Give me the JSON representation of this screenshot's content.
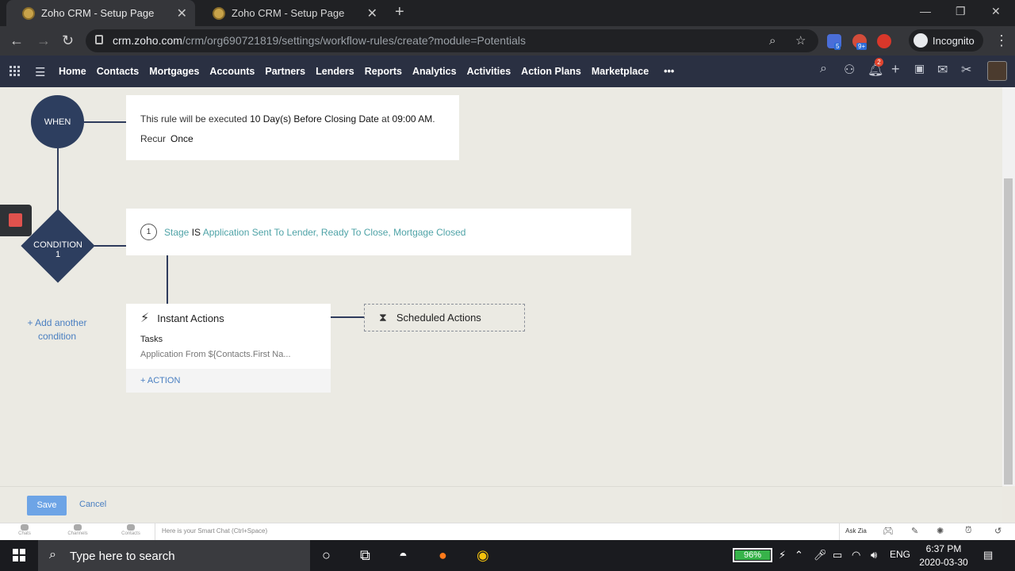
{
  "browser": {
    "tabs": [
      {
        "title": "Zoho CRM - Setup Page"
      },
      {
        "title": "Zoho CRM - Setup Page"
      }
    ],
    "url_domain": "crm.zoho.com",
    "url_path": "/crm/org690721819/settings/workflow-rules/create?module=Potentials",
    "incognito_label": "Incognito",
    "extension_badges": [
      "5",
      "9+"
    ]
  },
  "nav": {
    "links": [
      "Home",
      "Contacts",
      "Mortgages",
      "Accounts",
      "Partners",
      "Lenders",
      "Reports",
      "Analytics",
      "Activities",
      "Action Plans",
      "Marketplace"
    ],
    "more": "•••",
    "notification_count": "2"
  },
  "workflow": {
    "when": {
      "node_label": "WHEN",
      "line1_prefix": "This rule will be executed ",
      "line1_emph": "10 Day(s) Before Closing Date",
      "line1_mid": " at ",
      "line1_time": "09:00 AM",
      "line1_end": ".",
      "recur_label": "Recur",
      "recur_value": "Once"
    },
    "condition": {
      "node_label_1": "CONDITION",
      "node_label_2": "1",
      "number": "1",
      "field": "Stage",
      "operator": " IS ",
      "values": "Application Sent To Lender, Ready To Close, Mortgage Closed"
    },
    "add_condition": {
      "line1": "+ Add another",
      "line2": "condition"
    },
    "instant_actions": {
      "title": "Instant Actions",
      "section": "Tasks",
      "item": "Application From ${Contacts.First Na...",
      "add_action": "+ ACTION"
    },
    "scheduled_actions": {
      "title": "Scheduled Actions"
    }
  },
  "footer": {
    "save": "Save",
    "cancel": "Cancel"
  },
  "chatbar": {
    "icons": [
      "Chats",
      "Channels",
      "Contacts"
    ],
    "placeholder": "Here is your Smart Chat (Ctrl+Space)",
    "ask_zia": "Ask Zia"
  },
  "taskbar": {
    "search_placeholder": "Type here to search",
    "battery": "96%",
    "language": "ENG",
    "time": "6:37 PM",
    "date": "2020-03-30"
  },
  "colors": {
    "node_navy": "#2d3e5f",
    "link_blue": "#4a7fc1",
    "teal": "#4fa3a7",
    "save_blue": "#6da4e6"
  }
}
